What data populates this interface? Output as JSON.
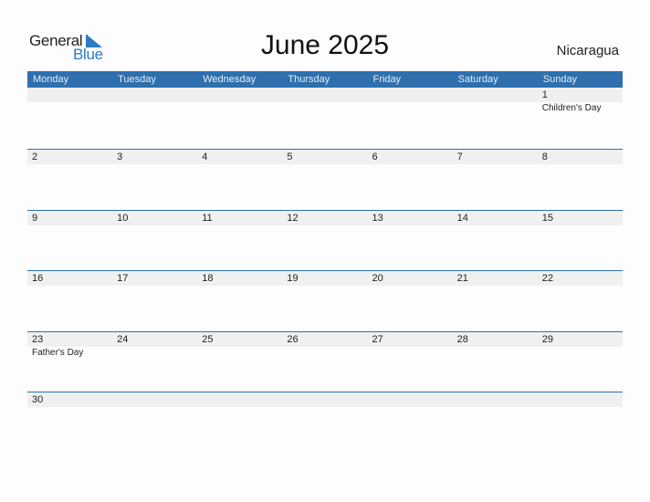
{
  "brand": {
    "line1": "General",
    "line2": "Blue"
  },
  "title": "June 2025",
  "country": "Nicaragua",
  "colors": {
    "header_bg": "#2e6fae",
    "band_bg": "#f0f0f0",
    "accent": "#2b7bc4"
  },
  "weekdays": [
    "Monday",
    "Tuesday",
    "Wednesday",
    "Thursday",
    "Friday",
    "Saturday",
    "Sunday"
  ],
  "weeks": [
    {
      "days": [
        {
          "n": "",
          "h": ""
        },
        {
          "n": "",
          "h": ""
        },
        {
          "n": "",
          "h": ""
        },
        {
          "n": "",
          "h": ""
        },
        {
          "n": "",
          "h": ""
        },
        {
          "n": "",
          "h": ""
        },
        {
          "n": "1",
          "h": "Children's Day"
        }
      ]
    },
    {
      "days": [
        {
          "n": "2",
          "h": ""
        },
        {
          "n": "3",
          "h": ""
        },
        {
          "n": "4",
          "h": ""
        },
        {
          "n": "5",
          "h": ""
        },
        {
          "n": "6",
          "h": ""
        },
        {
          "n": "7",
          "h": ""
        },
        {
          "n": "8",
          "h": ""
        }
      ]
    },
    {
      "days": [
        {
          "n": "9",
          "h": ""
        },
        {
          "n": "10",
          "h": ""
        },
        {
          "n": "11",
          "h": ""
        },
        {
          "n": "12",
          "h": ""
        },
        {
          "n": "13",
          "h": ""
        },
        {
          "n": "14",
          "h": ""
        },
        {
          "n": "15",
          "h": ""
        }
      ]
    },
    {
      "days": [
        {
          "n": "16",
          "h": ""
        },
        {
          "n": "17",
          "h": ""
        },
        {
          "n": "18",
          "h": ""
        },
        {
          "n": "19",
          "h": ""
        },
        {
          "n": "20",
          "h": ""
        },
        {
          "n": "21",
          "h": ""
        },
        {
          "n": "22",
          "h": ""
        }
      ]
    },
    {
      "days": [
        {
          "n": "23",
          "h": "Father's Day"
        },
        {
          "n": "24",
          "h": ""
        },
        {
          "n": "25",
          "h": ""
        },
        {
          "n": "26",
          "h": ""
        },
        {
          "n": "27",
          "h": ""
        },
        {
          "n": "28",
          "h": ""
        },
        {
          "n": "29",
          "h": ""
        }
      ]
    },
    {
      "days": [
        {
          "n": "30",
          "h": ""
        },
        {
          "n": "",
          "h": ""
        },
        {
          "n": "",
          "h": ""
        },
        {
          "n": "",
          "h": ""
        },
        {
          "n": "",
          "h": ""
        },
        {
          "n": "",
          "h": ""
        },
        {
          "n": "",
          "h": ""
        }
      ]
    }
  ]
}
